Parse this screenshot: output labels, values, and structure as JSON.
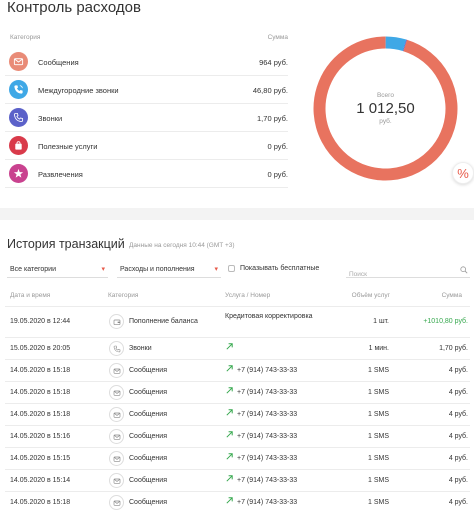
{
  "control": {
    "title": "Контроль расходов",
    "col_category": "Категория",
    "col_sum": "Сумма",
    "categories": [
      {
        "label": "Сообщения",
        "amount": "964 руб.",
        "icon": "envelope-icon",
        "color": "#e98b77"
      },
      {
        "label": "Междугородние звонки",
        "amount": "46,80 руб.",
        "icon": "phone-call-icon",
        "color": "#3fa8e6"
      },
      {
        "label": "Звонки",
        "amount": "1,70 руб.",
        "icon": "phone-icon",
        "color": "#5b61c9"
      },
      {
        "label": "Полезные услуги",
        "amount": "0 руб.",
        "icon": "bag-icon",
        "color": "#d93a4a"
      },
      {
        "label": "Развлечения",
        "amount": "0 руб.",
        "icon": "star-icon",
        "color": "#c9428f"
      }
    ],
    "total_label": "Всего",
    "total_value": "1 012,50",
    "total_unit": "руб.",
    "percent_button": "%",
    "donut_colors": {
      "main": "#e8735f",
      "accent": "#3fa8e6"
    },
    "donut_share": {
      "messages": 0.952,
      "long_distance": 0.046,
      "calls": 0.002
    }
  },
  "transactions": {
    "title": "История транзакций",
    "subtitle": "Данные на сегодня 10:44 (GMT +3)",
    "filter_category": "Все категории",
    "filter_type": "Расходы и пополнения",
    "show_free_label": "Показывать бесплатные",
    "search_placeholder": "Поиск",
    "headers": {
      "date": "Дата и время",
      "category": "Категория",
      "service": "Услуга / Номер",
      "volume": "Объём услуг",
      "sum": "Сумма"
    },
    "rows": [
      {
        "date": "19.05.2020 в 12:44",
        "category": "Пополнение баланса",
        "service": "Кредитовая корректировка",
        "volume": "1 шт.",
        "sum": "+1010,80 руб.",
        "icon": "wallet-icon",
        "tall": true,
        "positive": true
      },
      {
        "date": "15.05.2020 в 20:05",
        "category": "Звонки",
        "service": "",
        "volume": "1 мин.",
        "sum": "1,70 руб.",
        "icon": "phone-icon",
        "tall": false,
        "positive": false
      },
      {
        "date": "14.05.2020 в 15:18",
        "category": "Сообщения",
        "service": "+7 (914) 743-33-33",
        "volume": "1 SMS",
        "sum": "4 руб.",
        "icon": "envelope-icon",
        "tall": false,
        "positive": false
      },
      {
        "date": "14.05.2020 в 15:18",
        "category": "Сообщения",
        "service": "+7 (914) 743-33-33",
        "volume": "1 SMS",
        "sum": "4 руб.",
        "icon": "envelope-icon",
        "tall": false,
        "positive": false
      },
      {
        "date": "14.05.2020 в 15:18",
        "category": "Сообщения",
        "service": "+7 (914) 743-33-33",
        "volume": "1 SMS",
        "sum": "4 руб.",
        "icon": "envelope-icon",
        "tall": false,
        "positive": false
      },
      {
        "date": "14.05.2020 в 15:16",
        "category": "Сообщения",
        "service": "+7 (914) 743-33-33",
        "volume": "1 SMS",
        "sum": "4 руб.",
        "icon": "envelope-icon",
        "tall": false,
        "positive": false
      },
      {
        "date": "14.05.2020 в 15:15",
        "category": "Сообщения",
        "service": "+7 (914) 743-33-33",
        "volume": "1 SMS",
        "sum": "4 руб.",
        "icon": "envelope-icon",
        "tall": false,
        "positive": false
      },
      {
        "date": "14.05.2020 в 15:14",
        "category": "Сообщения",
        "service": "+7 (914) 743-33-33",
        "volume": "1 SMS",
        "sum": "4 руб.",
        "icon": "envelope-icon",
        "tall": false,
        "positive": false
      },
      {
        "date": "14.05.2020 в 15:18",
        "category": "Сообщения",
        "service": "+7 (914) 743-33-33",
        "volume": "1 SMS",
        "sum": "4 руб.",
        "icon": "envelope-icon",
        "tall": false,
        "positive": false
      }
    ]
  }
}
